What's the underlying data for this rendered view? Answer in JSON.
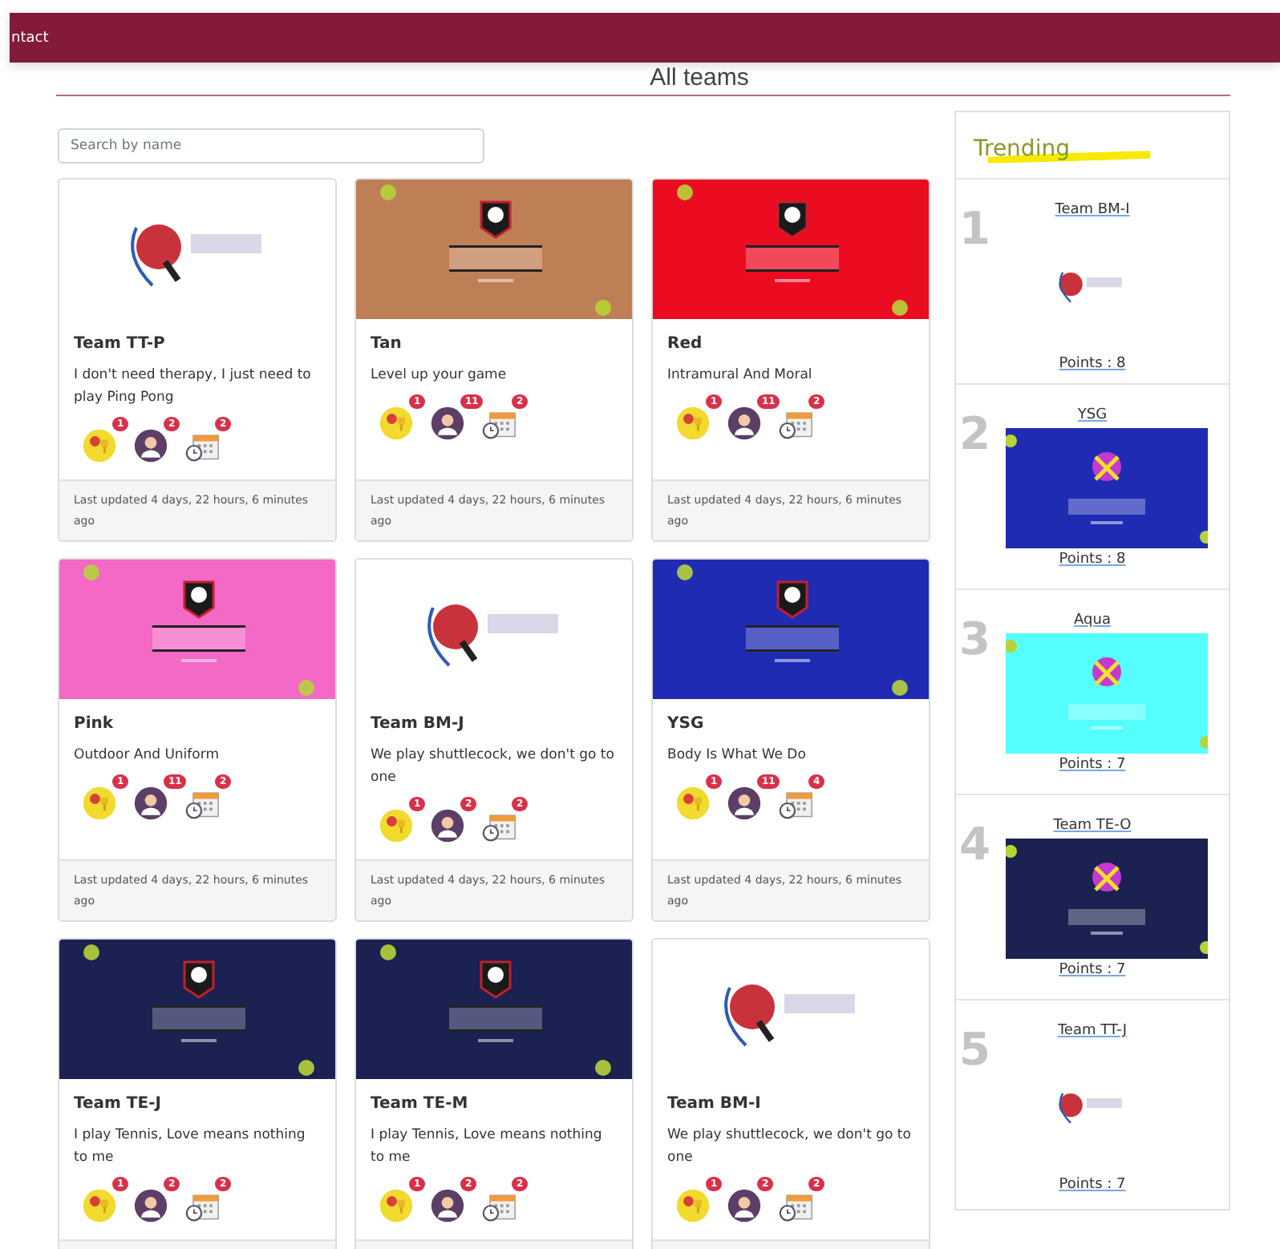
{
  "navbar": {
    "link": "ntact"
  },
  "heading": "All teams",
  "search": {
    "placeholder": "Search by name"
  },
  "teams": [
    {
      "name": "Team TT-P",
      "description": "I don't need therapy, I just need to play Ping Pong",
      "stats": [
        {
          "kind": "award",
          "count": "1"
        },
        {
          "kind": "members",
          "count": "2"
        },
        {
          "kind": "events",
          "count": "2"
        }
      ],
      "updated": "Last updated 4 days, 22 hours, 6 minutes ago"
    },
    {
      "name": "Tan",
      "description": "Level up your game",
      "stats": [
        {
          "kind": "award",
          "count": "1"
        },
        {
          "kind": "members",
          "count": "11"
        },
        {
          "kind": "events",
          "count": "2"
        }
      ],
      "updated": "Last updated 4 days, 22 hours, 6 minutes ago"
    },
    {
      "name": "Red",
      "description": "Intramural And Moral",
      "stats": [
        {
          "kind": "award",
          "count": "1"
        },
        {
          "kind": "members",
          "count": "11"
        },
        {
          "kind": "events",
          "count": "2"
        }
      ],
      "updated": "Last updated 4 days, 22 hours, 6 minutes ago"
    },
    {
      "name": "Pink",
      "description": "Outdoor And Uniform",
      "stats": [
        {
          "kind": "award",
          "count": "1"
        },
        {
          "kind": "members",
          "count": "11"
        },
        {
          "kind": "events",
          "count": "2"
        }
      ],
      "updated": "Last updated 4 days, 22 hours, 6 minutes ago"
    },
    {
      "name": "Team BM-J",
      "description": "We play shuttlecock, we don't go to one",
      "stats": [
        {
          "kind": "award",
          "count": "1"
        },
        {
          "kind": "members",
          "count": "2"
        },
        {
          "kind": "events",
          "count": "2"
        }
      ],
      "updated": "Last updated 4 days, 22 hours, 6 minutes ago"
    },
    {
      "name": "YSG",
      "description": "Body Is What We Do",
      "stats": [
        {
          "kind": "award",
          "count": "1"
        },
        {
          "kind": "members",
          "count": "11"
        },
        {
          "kind": "events",
          "count": "4"
        }
      ],
      "updated": "Last updated 4 days, 22 hours, 6 minutes ago"
    },
    {
      "name": "Team TE-J",
      "description": "I play Tennis, Love means nothing to me",
      "stats": [
        {
          "kind": "award",
          "count": "1"
        },
        {
          "kind": "members",
          "count": "2"
        },
        {
          "kind": "events",
          "count": "2"
        }
      ]
    },
    {
      "name": "Team TE-M",
      "description": "I play Tennis, Love means nothing to me",
      "stats": [
        {
          "kind": "award",
          "count": "1"
        },
        {
          "kind": "members",
          "count": "2"
        },
        {
          "kind": "events",
          "count": "2"
        }
      ]
    },
    {
      "name": "Team BM-I",
      "description": "We play shuttlecock, we don't go to one",
      "stats": [
        {
          "kind": "award",
          "count": "1"
        },
        {
          "kind": "members",
          "count": "2"
        },
        {
          "kind": "events",
          "count": "2"
        }
      ]
    }
  ],
  "trending": {
    "title": "Trending",
    "items": [
      {
        "rank": "1",
        "name": "Team BM-I",
        "points": "Points : 8"
      },
      {
        "rank": "2",
        "name": "YSG",
        "points": "Points : 8"
      },
      {
        "rank": "3",
        "name": "Aqua",
        "points": "Points : 7"
      },
      {
        "rank": "4",
        "name": "Team TE-O",
        "points": "Points : 7"
      },
      {
        "rank": "5",
        "name": "Team TT-J",
        "points": "Points : 7"
      }
    ]
  }
}
